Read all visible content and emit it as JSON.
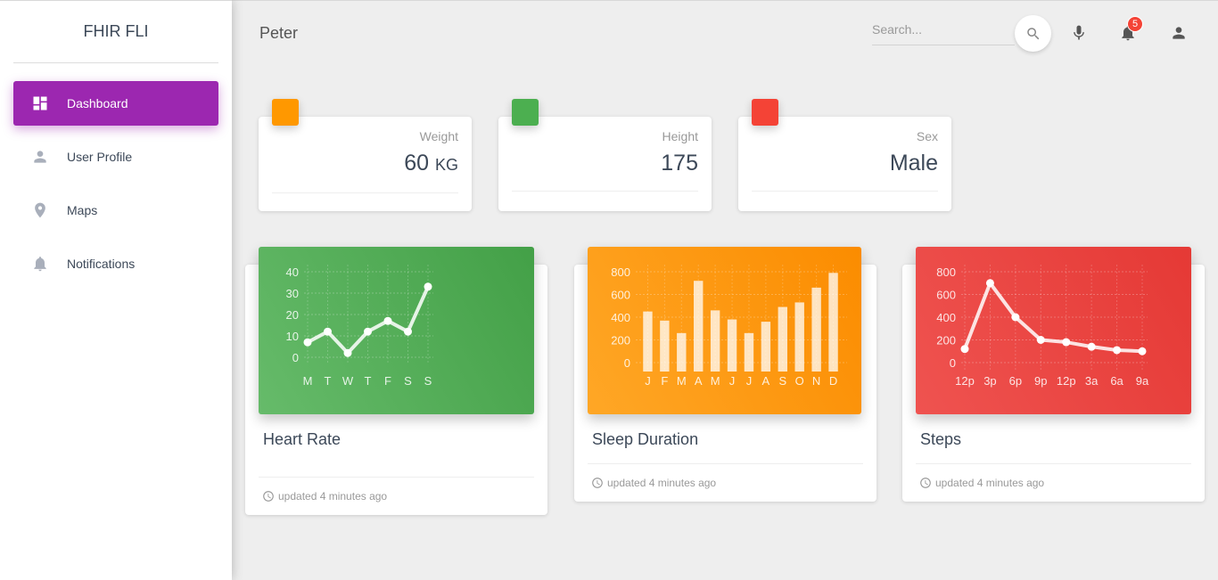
{
  "app": {
    "title": "FHIR FLI"
  },
  "sidebar": {
    "items": [
      {
        "label": "Dashboard",
        "icon": "dashboard-icon",
        "active": true
      },
      {
        "label": "User Profile",
        "icon": "person-icon",
        "active": false
      },
      {
        "label": "Maps",
        "icon": "location-icon",
        "active": false
      },
      {
        "label": "Notifications",
        "icon": "bell-icon",
        "active": false
      }
    ],
    "active_color": "#9c27b0"
  },
  "topbar": {
    "user_name": "Peter",
    "search_placeholder": "Search...",
    "notification_count": "5"
  },
  "stats": [
    {
      "category": "Weight",
      "value": "60",
      "unit": "KG",
      "color": "#ff9800"
    },
    {
      "category": "Height",
      "value": "175",
      "unit": "",
      "color": "#4caf50"
    },
    {
      "category": "Sex",
      "value": "Male",
      "unit": "",
      "color": "#f44336"
    }
  ],
  "charts": [
    {
      "title": "Heart Rate",
      "footer": "updated 4 minutes ago",
      "color_from": "#66bb6a",
      "color_to": "#43a047"
    },
    {
      "title": "Sleep Duration",
      "footer": "updated 4 minutes ago",
      "color_from": "#ffa726",
      "color_to": "#fb8c00"
    },
    {
      "title": "Steps",
      "footer": "updated 4 minutes ago",
      "color_from": "#ef5350",
      "color_to": "#e53935"
    }
  ],
  "chart_data": [
    {
      "type": "line",
      "title": "Heart Rate",
      "categories": [
        "M",
        "T",
        "W",
        "T",
        "F",
        "S",
        "S"
      ],
      "values": [
        7,
        12,
        2,
        12,
        17,
        12,
        33
      ],
      "yticks": [
        "40",
        "30",
        "20",
        "10",
        "0"
      ],
      "ylim": [
        0,
        40
      ],
      "grid": true
    },
    {
      "type": "bar",
      "title": "Sleep Duration",
      "categories": [
        "J",
        "F",
        "M",
        "A",
        "M",
        "J",
        "J",
        "A",
        "S",
        "O",
        "N",
        "D"
      ],
      "values": [
        450,
        370,
        260,
        720,
        460,
        380,
        260,
        360,
        490,
        530,
        660,
        790
      ],
      "yticks": [
        "800",
        "600",
        "400",
        "200",
        "0"
      ],
      "ylim": [
        0,
        800
      ],
      "grid": true
    },
    {
      "type": "line",
      "title": "Steps",
      "categories": [
        "12p",
        "3p",
        "6p",
        "9p",
        "12p",
        "3a",
        "6a",
        "9a"
      ],
      "values": [
        120,
        700,
        400,
        200,
        180,
        140,
        110,
        100
      ],
      "yticks": [
        "800",
        "600",
        "400",
        "200",
        "0"
      ],
      "ylim": [
        0,
        800
      ],
      "grid": true
    }
  ]
}
